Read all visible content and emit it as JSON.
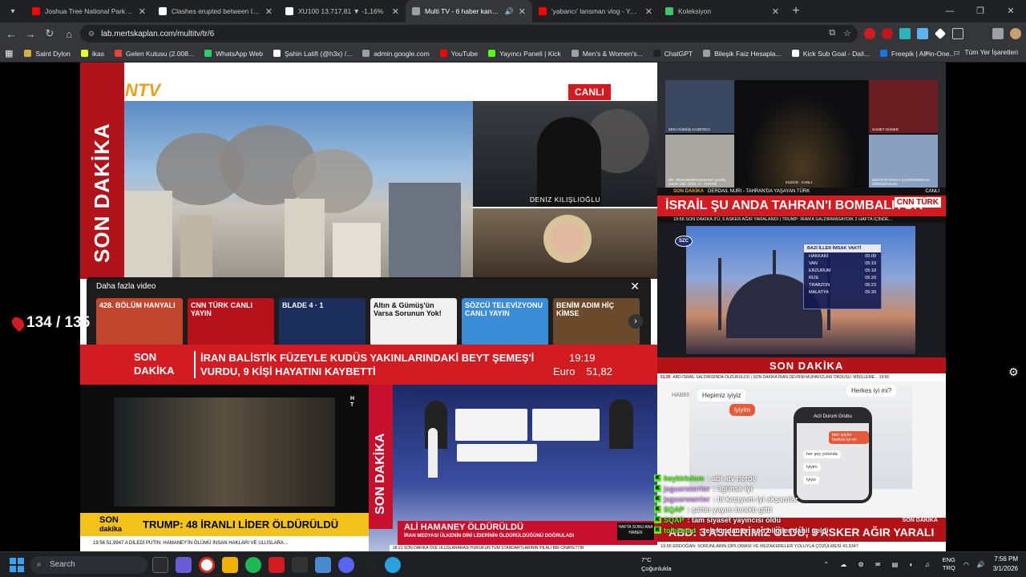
{
  "browser": {
    "tabs": [
      {
        "label": "Joshua Tree National Park 4K S...",
        "favicon_color": "#ff0000",
        "active": false
      },
      {
        "label": "Clashes erupted between Iraqi...",
        "favicon_color": "#ffffff",
        "active": false
      },
      {
        "label": "XU100 13.717,81 ▼ -1,16%",
        "favicon_color": "#ffffff",
        "active": false
      },
      {
        "label": "Multi TV - 6 haber kanalını...",
        "favicon_color": "#9aa0a6",
        "active": true
      },
      {
        "label": "'yabancı' lansman vlog - YouTub...",
        "favicon_color": "#ff0000",
        "active": false
      },
      {
        "label": "Koleksiyon",
        "favicon_color": "#3ec26b",
        "active": false
      }
    ],
    "new_tab": "+",
    "url": "lab.mertskaplan.com/multitv/tr/6",
    "bookmarks": [
      {
        "label": "Saint Dylon",
        "color": "#d4b23a"
      },
      {
        "label": "ikas",
        "color": "#e7ff2d"
      },
      {
        "label": "Gelen Kutusu (2.008...",
        "color": "#ea4335"
      },
      {
        "label": "WhatsApp Web",
        "color": "#25d366"
      },
      {
        "label": "Şahin Latifi (@h3x) /...",
        "color": "#ffffff"
      },
      {
        "label": "admin.google.com",
        "color": "#9aa0a6"
      },
      {
        "label": "YouTube",
        "color": "#ff0000"
      },
      {
        "label": "Yayıncı Paneli | Kick",
        "color": "#53fc18"
      },
      {
        "label": "Men's & Women's...",
        "color": "#9aa0a6"
      },
      {
        "label": "ChatGPT",
        "color": "#202124"
      },
      {
        "label": "Bileşik Faiz Hesapla...",
        "color": "#9aa0a6"
      },
      {
        "label": "Kick Sub Goal - Dail...",
        "color": "#ffffff"
      },
      {
        "label": "Freepik | All-in-One...",
        "color": "#1a73e8"
      }
    ],
    "bookmarks_more": "»",
    "all_bookmarks": "Tüm Yer İşaretleri"
  },
  "counter": "134 / 135",
  "ntv": {
    "logo": "NTV",
    "side": "SON DAKİKA",
    "live": "CANLI",
    "anchor_name": "DENİZ KILIŞLIOĞLU",
    "more_videos": "Daha fazla video",
    "close": "✕",
    "thumbs": [
      {
        "label": "428. BÖLÜM HANYALI",
        "color": "#c0452c"
      },
      {
        "label": "CNN TÜRK CANLI YAYIN",
        "color": "#b5121b"
      },
      {
        "label": "BLADE 4 · 1",
        "color": "#1b2d5a"
      },
      {
        "label": "Altın & Gümüş'ün Varsa Sorunun Yok!",
        "color": "#f0f0f0"
      },
      {
        "label": "SÖZCÜ TELEVİZYONU CANLI YAYIN",
        "color": "#3a8cd6"
      },
      {
        "label": "BENİM ADIM HİÇ KİMSE",
        "color": "#6a4a2a"
      }
    ],
    "ticker_sd": "SON DAKİKA",
    "ticker_head": "İRAN BALİSTİK FÜZEYLE KUDÜS YAKINLARINDAKİ BEYT ŞEMEŞ'İ VURDU, 9 KİŞİ HAYATINI KAYBETTİ",
    "time": "19:19",
    "euro_label": "Euro",
    "euro_value": "51,82"
  },
  "cnn": {
    "q1_label": "ZEKİ GÜMÜŞ GAZETECİ",
    "q2_label": "SAMET GÜNER",
    "q3_label": "DR. MUHAMMED MAZHAR ŞAHİN USAK ÜNİ. ÖĞR. Ü. - RATAM",
    "q4_label": "İSRAİL'İN İRAN'A SALDIRISINDAN GÖRÜNTÜLER",
    "city_label": "KUDÜS - CANLI",
    "strip_sd": "SON DAKİKA",
    "strip": "DERDAIL NURI - TAHRAN'DA YAŞAYAN TÜRK",
    "strip_live": "CANLI",
    "headline": "İSRAİL ŞU ANDA TAHRAN'I BOMBALIYOR",
    "logo": "CNN TÜRK",
    "ticker": "19:56  SON DAKİKA  3'Ü, 5 ASKER AĞIR YARALANDI  |  TRUMP: İRAN'A SALDIRMASAYDIK 2 HAFTA İÇİNDE..."
  },
  "szc": {
    "logo": "SZC",
    "imsak_title": "BAZI İLLER İMSAK VAKTİ",
    "imsak": [
      {
        "city": "HAKKARİ",
        "time": "05:09"
      },
      {
        "city": "VAN",
        "time": "05:10"
      },
      {
        "city": "ERZURUM",
        "time": "05:18"
      },
      {
        "city": "RİZE",
        "time": "05:20"
      },
      {
        "city": "TRABZON",
        "time": "05:23"
      },
      {
        "city": "MALATYA",
        "time": "05:30"
      }
    ]
  },
  "dark": {
    "tag": "H\nT"
  },
  "trump": {
    "sd1": "SON",
    "sd2": "dakika",
    "head": "TRUMP: 48 İRANLI LİDER ÖLDÜRÜLDÜ",
    "ticker": "19:56  51,9947  A DİLEDİ  PUTİN: HAMANEY'İN ÖLÜMÜ İNSAN HAKLARI VE ULUSLARA..."
  },
  "halk": {
    "side": "SON DAKİKA",
    "head": "ALİ HAMANEY ÖLDÜRÜLDÜ",
    "sub": "İRAN MEDYASI ÜLKENİN DİNİ LİDERİNİN ÖLDÜRÜLDÜĞÜNÜ DOĞRULADI",
    "hafta": "HAFTA SONU ANA HABER",
    "ticker": "18:21  SON DAKİKA  ÖVE ULUSLARARASI HUKUKUN TÜM STANDARTLARININ İHLALİ BİR CİNAYETTİR"
  },
  "haber": {
    "top": "SON DAKİKA",
    "strip_time": "51,95",
    "strip": "ABD-İSRAİL SALDIRISINDA ÖLDÜRÜLDÜ  |  SON DAKİKA  İRAN DEVRİM MUHAFIZLARI ORDUSU: MİSİLLEME...  19:56",
    "label": "HABER",
    "phone_title": "Acil Durum Grubu",
    "msgs": [
      "ben iyiyim herkes iyi mi",
      "her şey yolunda",
      "iyiyim",
      "iyiyiz"
    ],
    "bub1": "Hepimiz iyiyiz",
    "bub2": "Herkes iyi mi?",
    "bub3": "iyiyim",
    "bar_sd": "SON DAKİKA",
    "bar_head": "ABD: 3 ASKERİMİZ ÖLDÜ, 5 ASKER AĞIR YARALI",
    "bar_ticker": "19:56  ERDOĞAN: SORUNLARIN DİPLOMASİ VE MÜZAKERELER YOLUYLA ÇÖZÜLMESİ  43,9347"
  },
  "chat": [
    {
      "user": "heykirkdom",
      "msg": ": abi atv nerde",
      "color": "#53fc18"
    },
    {
      "user": "jaguarwarrior",
      "msg": ": 3günse iyi",
      "color": "#e0a0ff"
    },
    {
      "user": "jaguarwarrior",
      "msg": ": bi kaçıyom iyi akşamlar",
      "color": "#e0a0ff"
    },
    {
      "user": "SQAP",
      "msg": ": şahin yayını bıraktı gitti",
      "color": "#53fc18"
    },
    {
      "user": "SQAP",
      "msg": ": tam siyaset yayıncısı oldu",
      "color": "#53fc18"
    },
    {
      "user": "tolhemad",
      "msg": ": telefondan en son bilgiler dahil geldi",
      "color": "#53fc18"
    }
  ],
  "taskbar": {
    "search": "Search",
    "weather_temp": "7°C",
    "weather_text": "Çoğunlukla",
    "lang1": "ENG",
    "lang2": "TRQ",
    "time": "7:56 PM",
    "date": "3/1/2026"
  }
}
